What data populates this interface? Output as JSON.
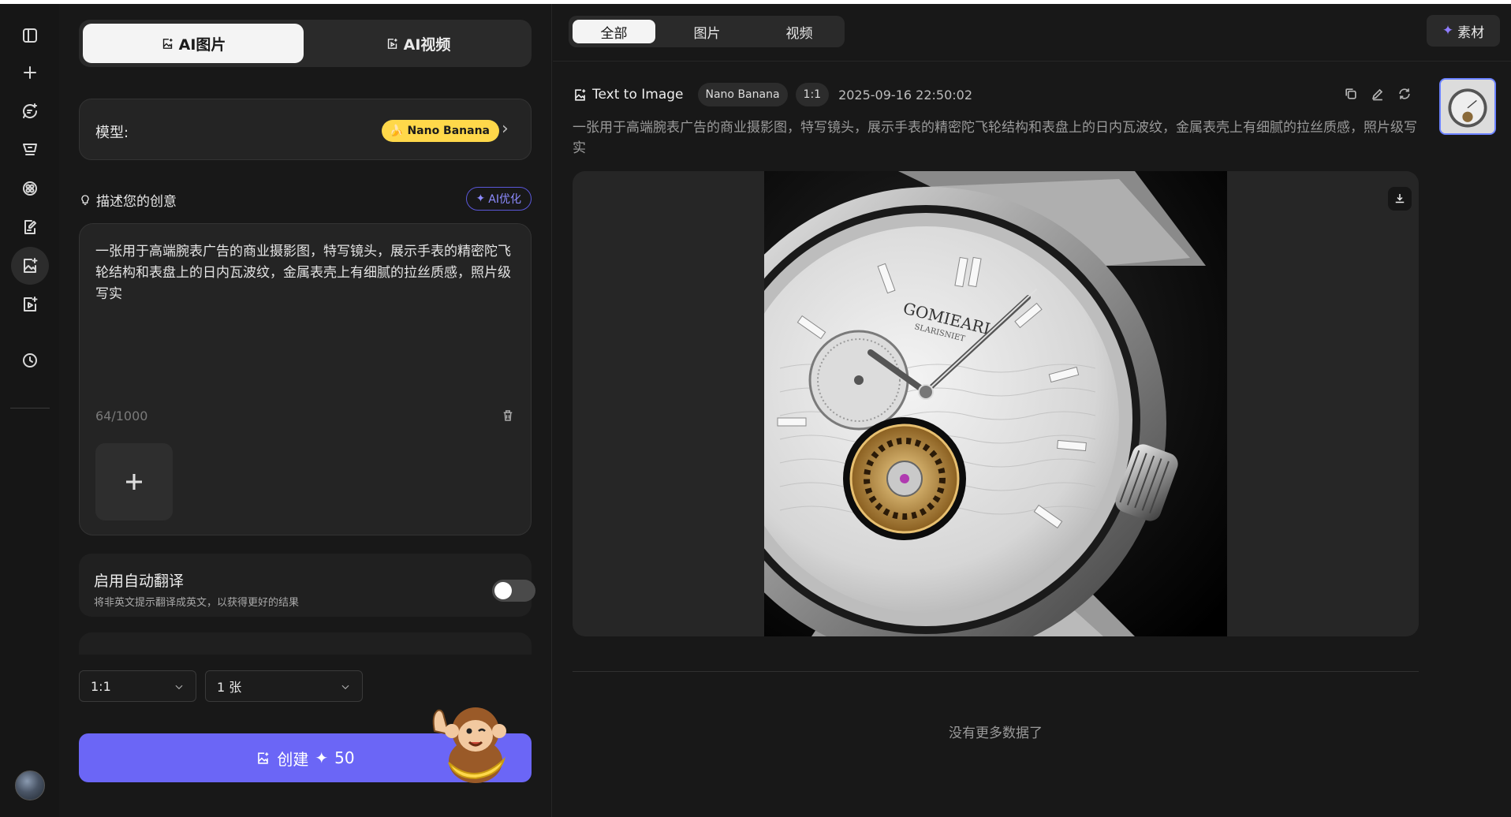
{
  "rail": {
    "items": [
      "panel-toggle-icon",
      "new-icon",
      "chat-ai-icon",
      "cart-icon",
      "apps-icon",
      "edit-doc-icon",
      "image-ai-icon",
      "video-ai-icon",
      "history-icon"
    ]
  },
  "mode_tabs": {
    "image": "AI图片",
    "video": "AI视频"
  },
  "model": {
    "label": "模型:",
    "name": "Nano Banana"
  },
  "describe": {
    "label": "描述您的创意",
    "optimize": "AI优化"
  },
  "prompt": {
    "text": "一张用于高端腕表广告的商业摄影图，特写镜头，展示手表的精密陀飞轮结构和表盘上的日内瓦波纹，金属表壳上有细腻的拉丝质感，照片级写实",
    "count": "64/1000"
  },
  "translate": {
    "title": "启用自动翻译",
    "subtitle": "将非英文提示翻译成英文，以获得更好的结果",
    "enabled": false
  },
  "selects": {
    "ratio": "1:1",
    "count": "1 张"
  },
  "create": {
    "label": "创建",
    "credits": "50"
  },
  "main_tabs": [
    "全部",
    "图片",
    "视频"
  ],
  "assets": {
    "label": "素材"
  },
  "result": {
    "type": "Text to Image",
    "model": "Nano Banana",
    "ratio": "1:1",
    "date": "2025-09-16 22:50:02",
    "prompt": "一张用于高端腕表广告的商业摄影图，特写镜头，展示手表的精密陀飞轮结构和表盘上的日内瓦波纹，金属表壳上有细腻的拉丝质感，照片级写实",
    "watch_brand": "GOMIEARI",
    "watch_sub": "SLARISNIET"
  },
  "footer": {
    "no_more": "没有更多数据了"
  },
  "colors": {
    "accent": "#6b66f6",
    "badge": "#ffd84a",
    "outline": "#5a57d8"
  }
}
